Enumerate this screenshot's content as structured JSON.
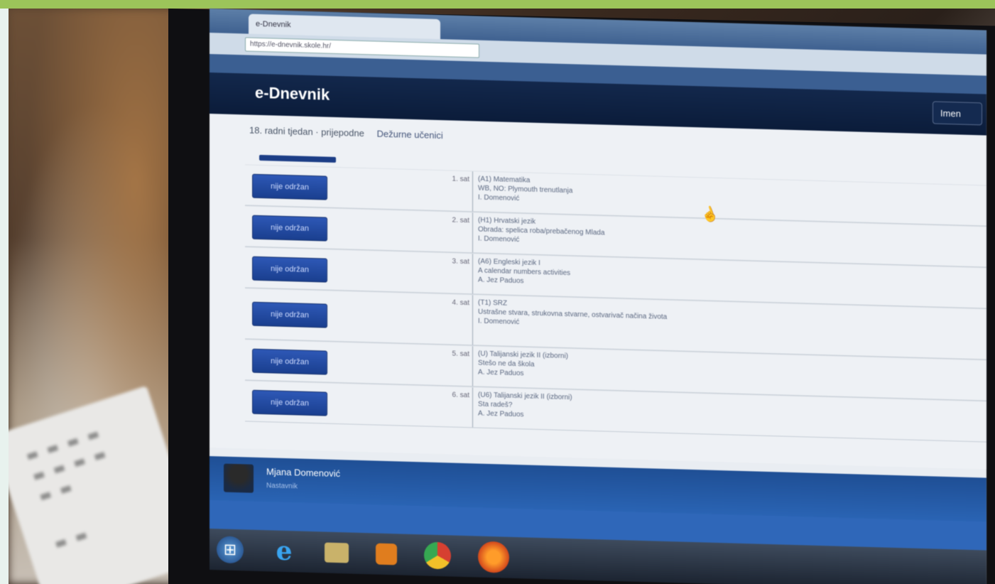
{
  "browser": {
    "tab_title": "e-Dnevnik",
    "address": "https://e-dnevnik.skole.hr/",
    "bookmarks": [
      "",
      "",
      "",
      "",
      ""
    ]
  },
  "app": {
    "title": "e-Dnevnik",
    "header_button": "Imen"
  },
  "breadcrumb": {
    "day": "18. radni tjedan · prijepodne",
    "link": "Dežurne učenici"
  },
  "rows": [
    {
      "button": "nije održan",
      "hour": "1. sat",
      "line1": "(A1) Matematika",
      "line2": "WB, NO: Plymouth trenutlanja",
      "line3": "I. Domenović"
    },
    {
      "button": "nije održan",
      "hour": "2. sat",
      "line1": "(H1) Hrvatski jezik",
      "line2": "Obrada: spelica roba/prebačenog Mlada",
      "line3": "I. Domenović"
    },
    {
      "button": "nije održan",
      "hour": "3. sat",
      "line1": "(A6) Engleski jezik I",
      "line2": "A calendar numbers activities",
      "line3": "A. Jez Paduos"
    },
    {
      "button": "nije održan",
      "hour": "4. sat",
      "line1": "(T1) SRZ",
      "line2": "Ustrašne stvara, strukovna stvarne, ostvarivač načina života",
      "line3": "I. Domenović"
    },
    {
      "button": "nije održan",
      "hour": "5. sat",
      "line1": "(U) Talijanski jezik II (izborni)",
      "line2": "Stešo ne da škola",
      "line3": "A. Jez Paduos"
    },
    {
      "button": "nije održan",
      "hour": "6. sat",
      "line1": "(U6) Talijanski jezik II (izborni)",
      "line2": "Sta radeš?",
      "line3": "A. Jez Paduos"
    }
  ],
  "user": {
    "name": "Mjana Domenović",
    "role": "Nastavnik"
  },
  "taskbar": [
    "start-icon",
    "internet-explorer-icon",
    "folder-icon",
    "media-player-icon",
    "chrome-icon",
    "firefox-icon"
  ]
}
